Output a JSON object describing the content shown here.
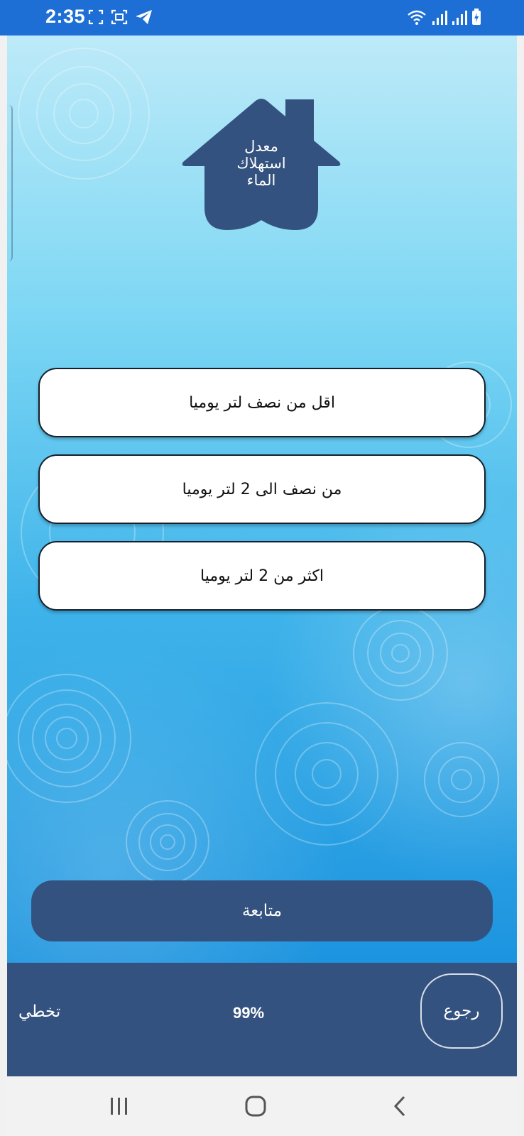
{
  "status_bar": {
    "time": "2:35",
    "left_icons": [
      "screenshot-icon",
      "screen-record-icon",
      "telegram-icon"
    ],
    "right_icons": [
      "wifi-icon",
      "signal-icon",
      "signal-icon",
      "battery-charging-icon"
    ]
  },
  "header": {
    "title_line1": "معدل",
    "title_line2": "استهلاك",
    "title_line3": "الماء"
  },
  "options": [
    {
      "label": "اقل من نصف لتر يوميا"
    },
    {
      "label": "من نصف الى 2 لتر يوميا"
    },
    {
      "label": "اكثر من 2 لتر يوميا"
    }
  ],
  "continue_label": "متابعة",
  "footer": {
    "skip_label": "تخطي",
    "progress": "99%",
    "back_label": "رجوع"
  },
  "nav": {
    "icons": [
      "recent-apps-icon",
      "home-icon",
      "back-icon"
    ]
  },
  "colors": {
    "status_bar": "#1d6fd6",
    "primary": "#34527f",
    "option_bg": "#ffffff"
  }
}
